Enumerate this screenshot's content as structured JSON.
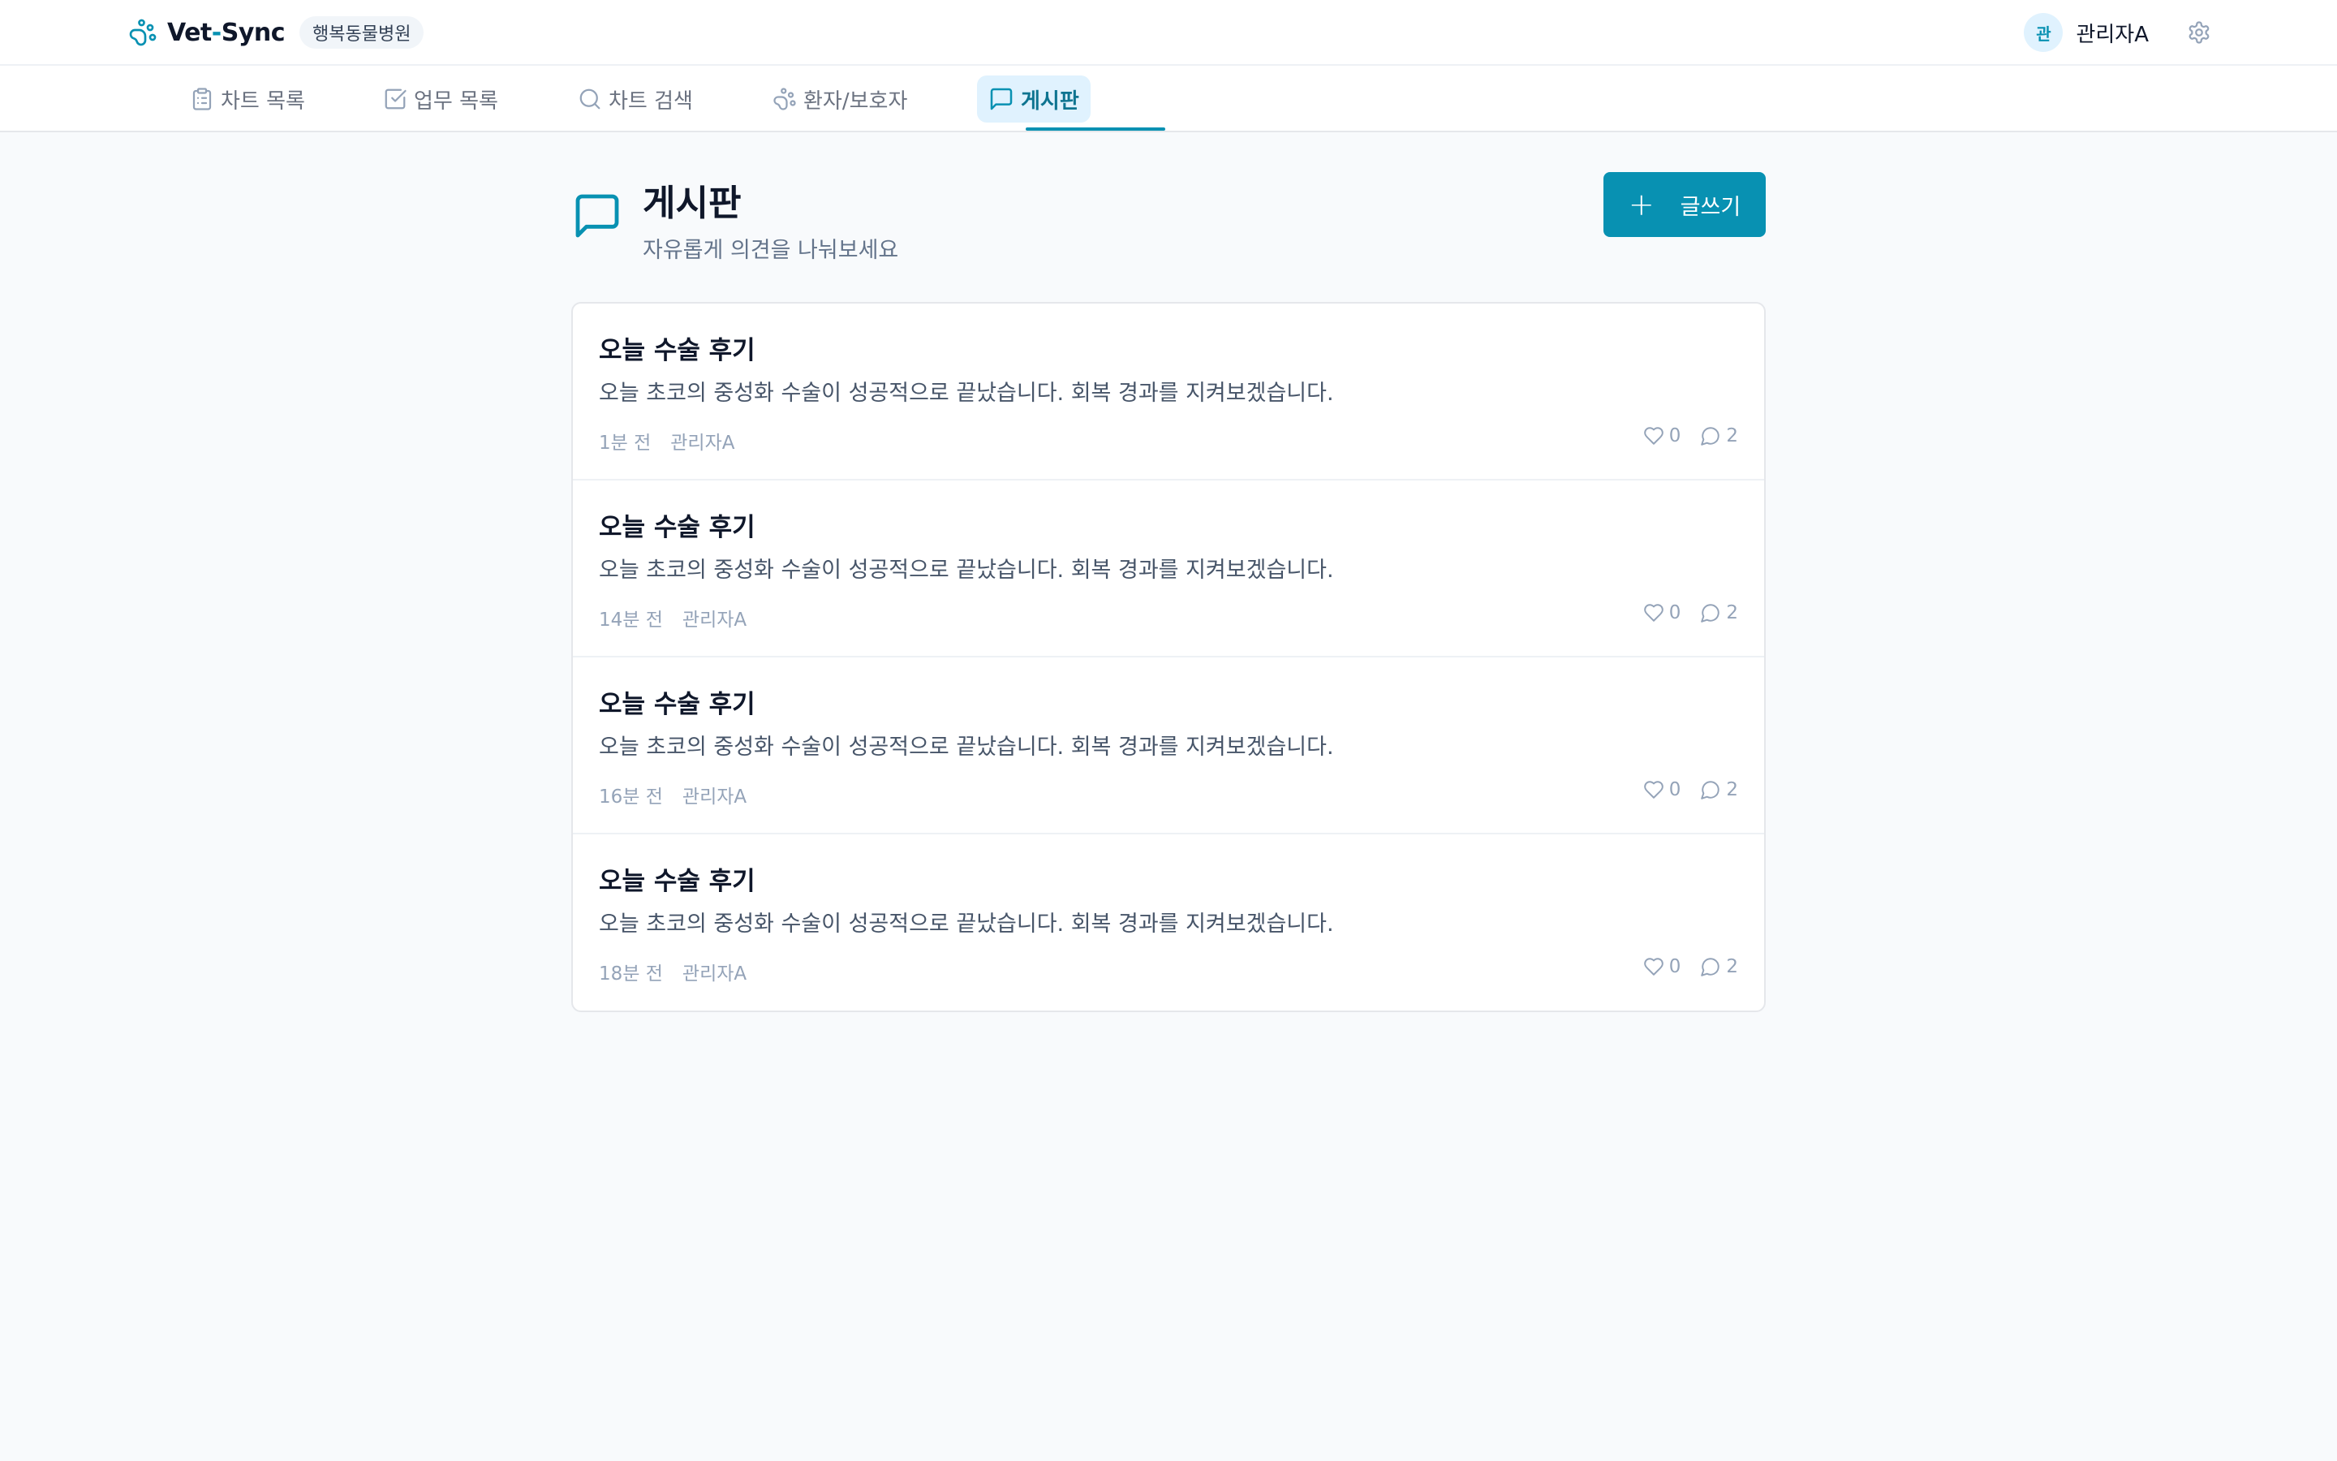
{
  "app": {
    "name_part1": "Vet",
    "name_dash": "-",
    "name_part2": "Sync",
    "clinic": "행복동물병원",
    "accent_color": "#0891b2"
  },
  "user": {
    "avatar_initial": "관",
    "name": "관리자A"
  },
  "nav": {
    "tabs": [
      {
        "label": "차트 목록",
        "icon": "clipboard-icon"
      },
      {
        "label": "업무 목록",
        "icon": "checkbox-icon"
      },
      {
        "label": "차트 검색",
        "icon": "search-icon"
      },
      {
        "label": "환자/보호자",
        "icon": "paw-icon"
      },
      {
        "label": "게시판",
        "icon": "message-icon",
        "active": true
      }
    ]
  },
  "page": {
    "title": "게시판",
    "subtitle": "자유롭게 의견을 나눠보세요",
    "write_label": "글쓰기"
  },
  "posts": [
    {
      "title": "오늘 수술 후기",
      "excerpt": "오늘 초코의 중성화 수술이 성공적으로 끝났습니다. 회복 경과를 지켜보겠습니다.",
      "time": "1분 전",
      "author": "관리자A",
      "likes": "0",
      "comments": "2"
    },
    {
      "title": "오늘 수술 후기",
      "excerpt": "오늘 초코의 중성화 수술이 성공적으로 끝났습니다. 회복 경과를 지켜보겠습니다.",
      "time": "14분 전",
      "author": "관리자A",
      "likes": "0",
      "comments": "2"
    },
    {
      "title": "오늘 수술 후기",
      "excerpt": "오늘 초코의 중성화 수술이 성공적으로 끝났습니다. 회복 경과를 지켜보겠습니다.",
      "time": "16분 전",
      "author": "관리자A",
      "likes": "0",
      "comments": "2"
    },
    {
      "title": "오늘 수술 후기",
      "excerpt": "오늘 초코의 중성화 수술이 성공적으로 끝났습니다. 회복 경과를 지켜보겠습니다.",
      "time": "18분 전",
      "author": "관리자A",
      "likes": "0",
      "comments": "2"
    }
  ]
}
